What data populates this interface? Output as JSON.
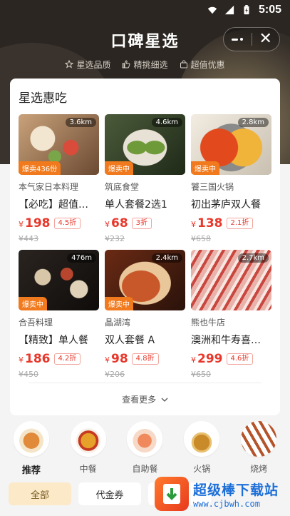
{
  "status": {
    "time": "5:05"
  },
  "header": {
    "title": "口碑星选",
    "features": [
      "星选品质",
      "精挑细选",
      "超值优惠"
    ]
  },
  "card": {
    "title": "星选惠吃",
    "see_more": "查看更多",
    "items": [
      {
        "distance": "3.6km",
        "badge": "爆卖436份",
        "shop": "本气家日本料理",
        "deal": "【必吃】超值…",
        "price": "198",
        "discount": "4.5折",
        "original": "¥443"
      },
      {
        "distance": "4.6km",
        "badge": "爆卖中",
        "shop": "筑底食堂",
        "deal": "单人套餐2选1",
        "price": "68",
        "discount": "3折",
        "original": "¥232"
      },
      {
        "distance": "2.8km",
        "badge": "爆卖中",
        "shop": "饕三国火锅",
        "deal": "初出茅庐双人餐",
        "price": "138",
        "discount": "2.1折",
        "original": "¥658"
      },
      {
        "distance": "476m",
        "badge": "爆卖中",
        "shop": "合吾料理",
        "deal": "【精致】单人餐",
        "price": "186",
        "discount": "4.2折",
        "original": "¥450"
      },
      {
        "distance": "2.4km",
        "badge": "爆卖中",
        "shop": "晶湖湾",
        "deal": "双人套餐 A",
        "price": "98",
        "discount": "4.8折",
        "original": "¥206"
      },
      {
        "distance": "2.7km",
        "badge": "",
        "shop": "熊也牛店",
        "deal": "澳洲和牛寿喜…",
        "price": "299",
        "discount": "4.6折",
        "original": "¥650"
      }
    ]
  },
  "currency": "¥",
  "categories": [
    {
      "label": "推荐",
      "active": true
    },
    {
      "label": "中餐",
      "active": false
    },
    {
      "label": "自助餐",
      "active": false
    },
    {
      "label": "火锅",
      "active": false
    },
    {
      "label": "烧烤",
      "active": false
    }
  ],
  "filters": [
    "全部",
    "代金券",
    ""
  ],
  "watermark": {
    "title": "超级棒下载站",
    "url": "www.cjbwh.com"
  },
  "colors": {
    "accent": "#e8372b",
    "badge": "#f07a1d",
    "header_bg": "#2b2622",
    "active_chip": "#fbe9c8"
  }
}
